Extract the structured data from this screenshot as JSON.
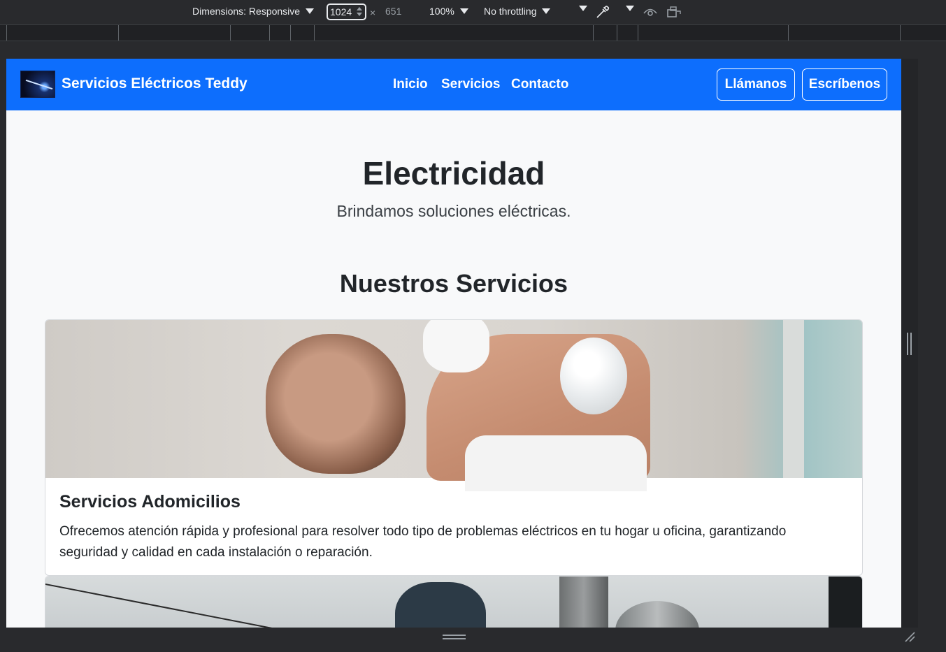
{
  "devtools": {
    "dimensions_label": "Dimensions: Responsive",
    "width": "1024",
    "times": "×",
    "height": "651",
    "zoom": "100%",
    "throttling": "No throttling"
  },
  "site": {
    "brand": "Servicios Eléctricos Teddy",
    "nav": [
      "Inicio",
      "Servicios",
      "Contacto"
    ],
    "buttons": [
      "Llámanos",
      "Escríbenos"
    ],
    "colors": {
      "primary": "#0d6efd",
      "background": "#f8f9fa",
      "text": "#212529"
    }
  },
  "hero": {
    "title": "Electricidad",
    "subtitle": "Brindamos soluciones eléctricas."
  },
  "services": {
    "heading": "Nuestros Servicios",
    "cards": [
      {
        "title": "Servicios Adomicilios",
        "text": "Ofrecemos atención rápida y profesional para resolver todo tipo de problemas eléctricos en tu hogar u oficina, garantizando seguridad y calidad en cada instalación o reparación."
      }
    ]
  }
}
